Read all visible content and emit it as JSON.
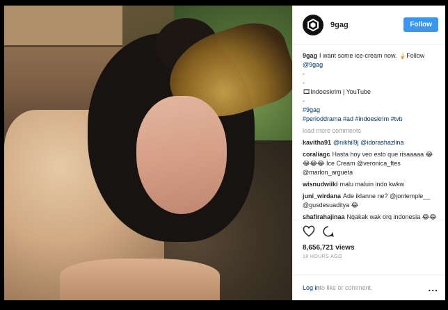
{
  "post": {
    "username": "9gag",
    "follow_label": "Follow",
    "caption": {
      "user": "9gag",
      "text": "I want some ice-cream now. 🍦Follow",
      "mention": "@9gag",
      "dash1": "-",
      "dash2": "-",
      "credit": "🎞Indoeskrim | YouTube",
      "dash3": "-",
      "tag1": "#9gag",
      "tags2": "#perioddrama #ad #indoeskrim #tvb"
    },
    "load_more": "load more comments",
    "comments": [
      {
        "user": "kavitha91",
        "text": "@nikhil9j @idorashazlina"
      },
      {
        "user": "coraliagc",
        "text": "Hasta hoy veo esto que risaaaaa 😂😂😂😂 Ice Cream @veronica_ftes @marlon_argueta"
      },
      {
        "user": "wisnudwiiki",
        "text": "malu maluin indo kwkw"
      },
      {
        "user": "juni_wirdana",
        "text": "Ade iklanne ne? @jontemple__ @gusdesuaditya 😂"
      },
      {
        "user": "shafirahajinaa",
        "text": "Ngakak wak org indonesia 😂😂 @salsaumara @cutnaba"
      }
    ],
    "views": "8,656,721 views",
    "time": "18 HOURS AGO",
    "login_link": "Log in",
    "login_text": " to like or comment.",
    "more": "..."
  },
  "icons": {
    "avatar": "9gag-logo-icon",
    "like": "heart-icon",
    "comment": "comment-bubble-icon",
    "more": "more-options-icon"
  },
  "colors": {
    "follow_button": "#3897f0",
    "link": "#003569",
    "muted": "#999999"
  }
}
